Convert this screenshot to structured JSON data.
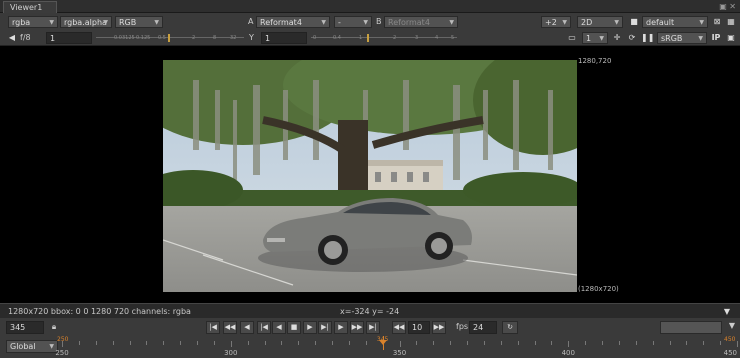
{
  "tab": {
    "title": "Viewer1"
  },
  "row1": {
    "channels": "rgba",
    "layer": "rgba.alpha",
    "display": "RGB",
    "a_label": "A",
    "a_input": "Reformat4",
    "op": "-",
    "b_label": "B",
    "b_input": "Reformat4",
    "zoom": "+2",
    "view_mode": "2D",
    "lut": "default"
  },
  "row2": {
    "fstop_label": "f/8",
    "gain_value": "1",
    "gain_ticks": [
      "0.03125",
      "0.125",
      "0.5",
      "2",
      "8",
      "32"
    ],
    "gamma_label": "Y",
    "gamma_value": "1",
    "gamma_ticks": [
      "0",
      "0.2",
      "0.4",
      "0.6",
      "0.8",
      "1",
      "2",
      "3",
      "4",
      "5"
    ],
    "view_left": "left",
    "view_right": "right",
    "proxy": "1",
    "colorspace": "sRGB",
    "ip_label": "IP"
  },
  "viewer": {
    "format_tr": "1280,720",
    "format_br": "(1280x720)"
  },
  "info": {
    "left_text": "1280x720 bbox: 0 0 1280 720 channels: rgba",
    "coords": "x=-324 y= -24"
  },
  "playback": {
    "frame": "345",
    "increment": "10",
    "fps_label": "fps",
    "fps_value": "24"
  },
  "timeline": {
    "range_mode": "Global",
    "start": "250",
    "end": "450",
    "current": "345",
    "labels": [
      "250",
      "300",
      "350",
      "400",
      "450"
    ]
  },
  "icons": {
    "lock": "lock-icon",
    "play": "play-icon",
    "stop": "stop-icon",
    "loop": "loop-icon"
  },
  "colors": {
    "accent": "#d9822b",
    "left_eye": "#e03030",
    "right_eye": "#5fc8e8"
  }
}
